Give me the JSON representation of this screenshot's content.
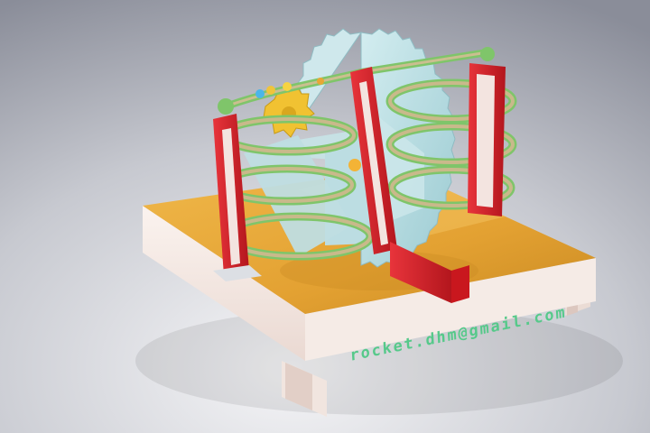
{
  "scene": {
    "base_inscription": "rocket.dhm@gmail.com"
  },
  "colors": {
    "background_light": "#f6f6f8",
    "background_dark": "#8a8d99",
    "base_top": "#e8a735",
    "base_side": "#f3e7e2",
    "frame_red": "#d8232a",
    "gear_blue": "#b9dde2",
    "rail_green": "#7fc56a",
    "rail_tan": "#c9b98b",
    "small_gear_yellow": "#f1c232",
    "inscription_green": "#56c98a"
  }
}
